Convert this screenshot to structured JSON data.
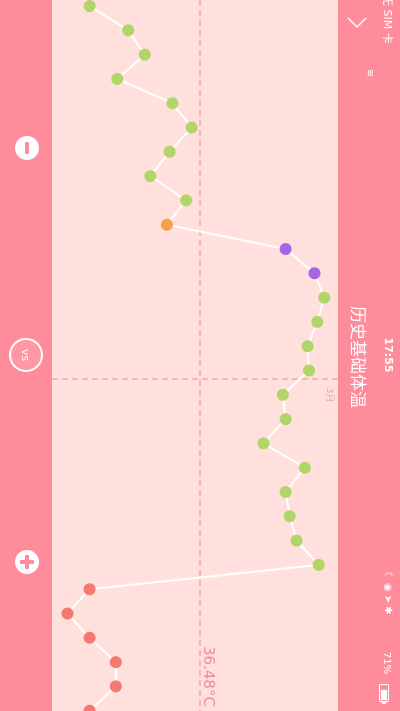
{
  "status_bar": {
    "carrier": "无 SIM 卡",
    "time": "17:55",
    "battery": "71%"
  },
  "header": {
    "title": "历史基础体温"
  },
  "left_bar": {
    "vs_label": "vs"
  },
  "chart_data": {
    "type": "line",
    "ref_temperature_label": "36.48°C",
    "month_marker": "3月",
    "colors": {
      "line": "#ffffff",
      "default_point": "#b2d56a",
      "highlight_point": "#f5a04a",
      "purple_point": "#a566e6",
      "period_point": "#f27a70",
      "guide": "#f08a95"
    },
    "points": [
      {
        "temp_offset": -0.8,
        "type": "default"
      },
      {
        "temp_offset": -0.52,
        "type": "default"
      },
      {
        "temp_offset": -0.4,
        "type": "default"
      },
      {
        "temp_offset": -0.6,
        "type": "default"
      },
      {
        "temp_offset": -0.2,
        "type": "default"
      },
      {
        "temp_offset": -0.06,
        "type": "default"
      },
      {
        "temp_offset": -0.22,
        "type": "default"
      },
      {
        "temp_offset": -0.36,
        "type": "default"
      },
      {
        "temp_offset": -0.1,
        "type": "default"
      },
      {
        "temp_offset": -0.24,
        "type": "highlight"
      },
      {
        "temp_offset": 0.62,
        "type": "purple"
      },
      {
        "temp_offset": 0.83,
        "type": "purple"
      },
      {
        "temp_offset": 0.9,
        "type": "default"
      },
      {
        "temp_offset": 0.85,
        "type": "default"
      },
      {
        "temp_offset": 0.78,
        "type": "default"
      },
      {
        "temp_offset": 0.79,
        "type": "default"
      },
      {
        "temp_offset": 0.6,
        "type": "default"
      },
      {
        "temp_offset": 0.62,
        "type": "default"
      },
      {
        "temp_offset": 0.46,
        "type": "default"
      },
      {
        "temp_offset": 0.76,
        "type": "default"
      },
      {
        "temp_offset": 0.62,
        "type": "default"
      },
      {
        "temp_offset": 0.65,
        "type": "default"
      },
      {
        "temp_offset": 0.7,
        "type": "default"
      },
      {
        "temp_offset": 0.86,
        "type": "default"
      },
      {
        "temp_offset": -0.8,
        "type": "period"
      },
      {
        "temp_offset": -0.96,
        "type": "period"
      },
      {
        "temp_offset": -0.8,
        "type": "period"
      },
      {
        "temp_offset": -0.61,
        "type": "period"
      },
      {
        "temp_offset": -0.61,
        "type": "period"
      },
      {
        "temp_offset": -0.8,
        "type": "period"
      }
    ]
  }
}
